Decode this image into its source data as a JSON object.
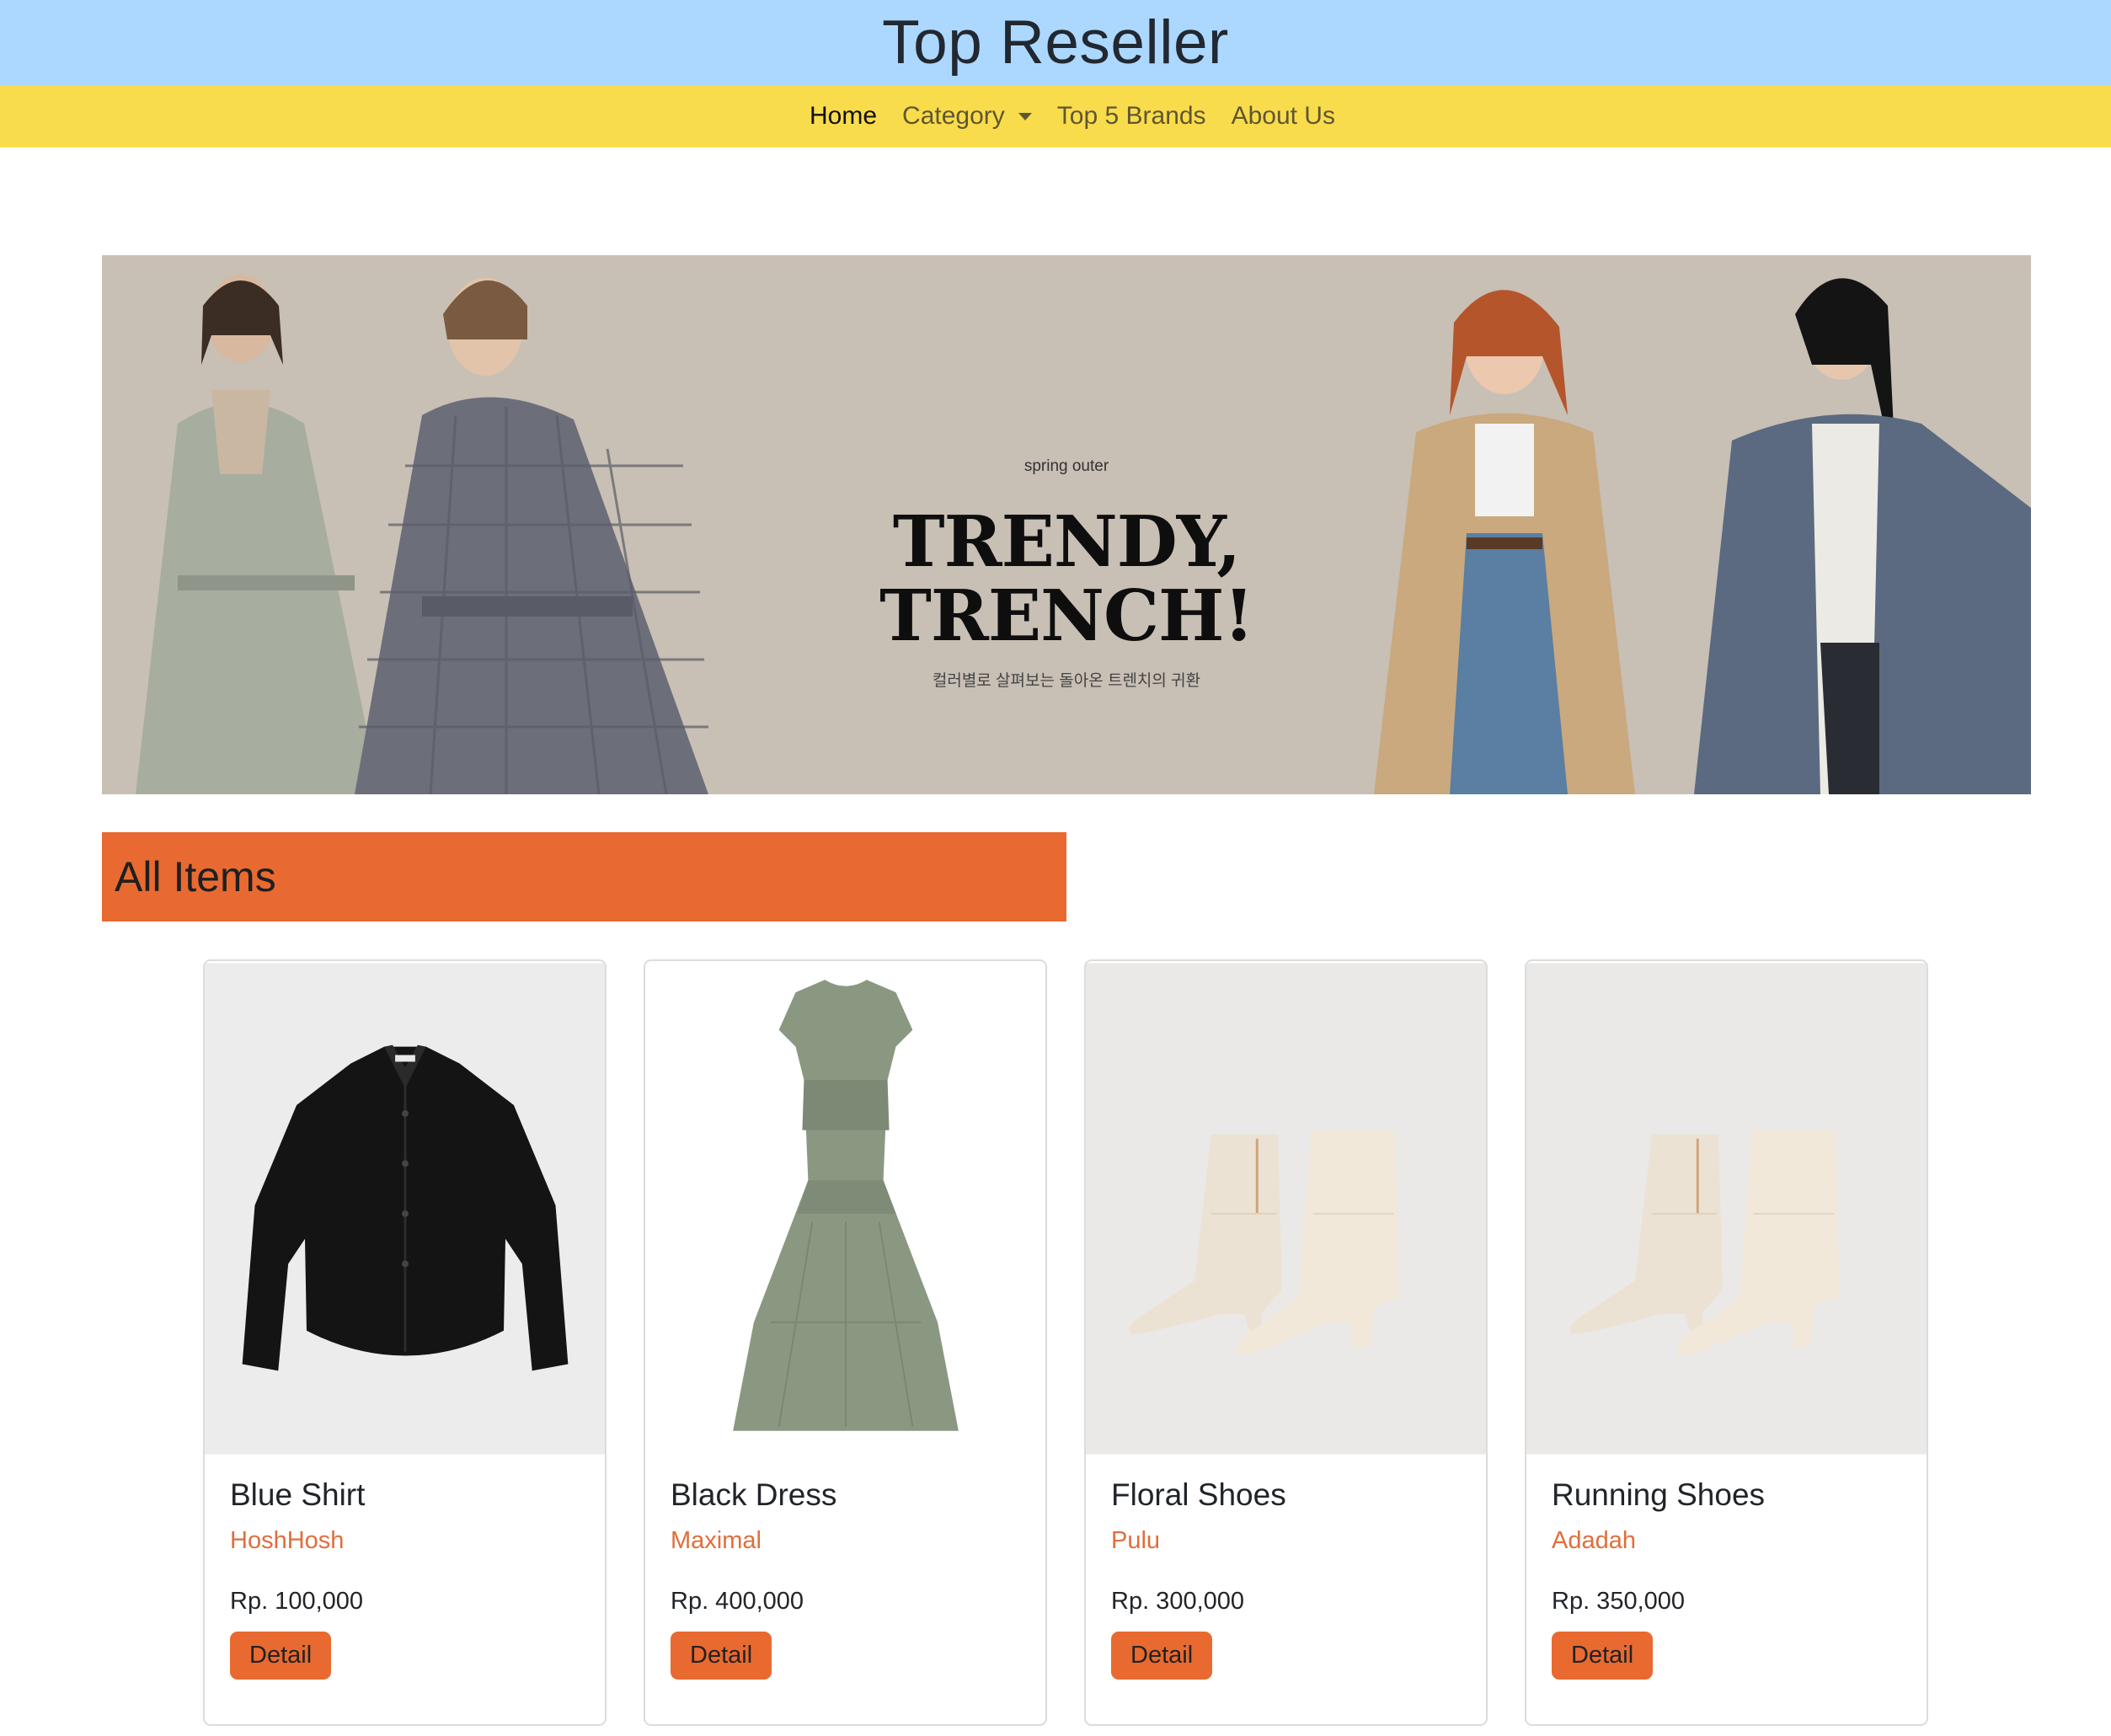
{
  "header": {
    "title": "Top Reseller"
  },
  "nav": {
    "items": [
      {
        "label": "Home",
        "active": true
      },
      {
        "label": "Category",
        "dropdown": true
      },
      {
        "label": "Top 5 Brands"
      },
      {
        "label": "About Us"
      }
    ]
  },
  "banner": {
    "kicker": "spring outer",
    "headline": "TRENDY,\nTRENCH!",
    "subtitle": "컬러별로 살펴보는 돌아온 트렌치의 귀환"
  },
  "section": {
    "title": "All Items"
  },
  "products": [
    {
      "name": "Blue Shirt",
      "brand": "HoshHosh",
      "price": "Rp. 100,000",
      "button": "Detail",
      "image": "black-silk-shirt"
    },
    {
      "name": "Black Dress",
      "brand": "Maximal",
      "price": "Rp. 400,000",
      "button": "Detail",
      "image": "green-dress"
    },
    {
      "name": "Floral Shoes",
      "brand": "Pulu",
      "price": "Rp. 300,000",
      "button": "Detail",
      "image": "cream-ankle-boots"
    },
    {
      "name": "Running Shoes",
      "brand": "Adadah",
      "price": "Rp. 350,000",
      "button": "Detail",
      "image": "cream-ankle-boots"
    }
  ],
  "colors": {
    "header_bg": "#acd8ff",
    "nav_bg": "#f9dc4b",
    "accent": "#e86a31",
    "brand_text": "#e06e3c"
  }
}
